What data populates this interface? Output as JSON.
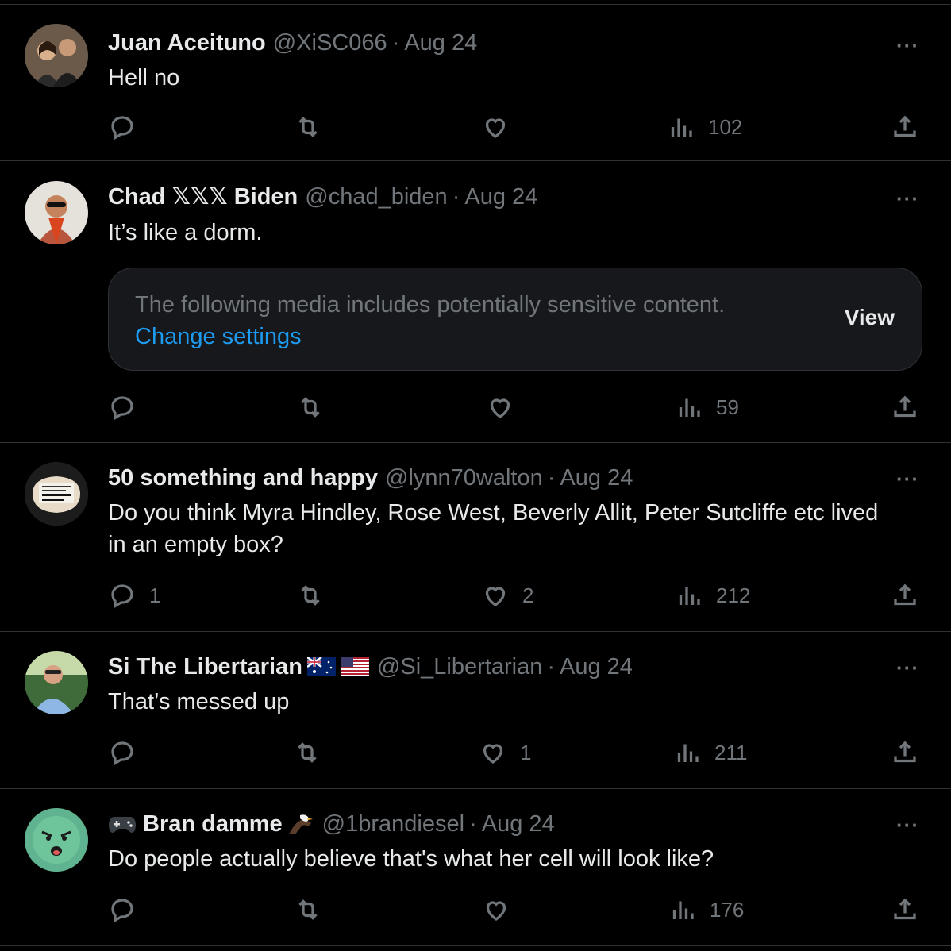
{
  "tweets": [
    {
      "name": "Juan Aceituno",
      "handle": "@XiSC066",
      "separator": "·",
      "date": "Aug 24",
      "text": "Hell no",
      "replies": "",
      "retweets": "",
      "likes": "",
      "views": "102"
    },
    {
      "name": "Chad 𝕏𝕏𝕏 Biden",
      "handle": "@chad_biden",
      "separator": "·",
      "date": "Aug 24",
      "text": "It’s like a dorm.",
      "sensitive": {
        "message": "The following media includes potentially sensitive content.",
        "change_settings": "Change settings",
        "view": "View"
      },
      "replies": "",
      "retweets": "",
      "likes": "",
      "views": "59"
    },
    {
      "name": "50 something and happy",
      "handle": "@lynn70walton",
      "separator": "·",
      "date": "Aug 24",
      "text": "Do you think Myra Hindley, Rose West, Beverly Allit, Peter Sutcliffe etc lived in an empty box?",
      "replies": "1",
      "retweets": "",
      "likes": "2",
      "views": "212"
    },
    {
      "name": "Si The Libertarian",
      "handle": "@Si_Libertarian",
      "separator": "·",
      "date": "Aug 24",
      "text": "That’s messed up",
      "replies": "",
      "retweets": "",
      "likes": "1",
      "views": "211"
    },
    {
      "name": "Bran damme",
      "handle": "@1brandiesel",
      "separator": "·",
      "date": "Aug 24",
      "text": "Do people actually believe that's what her cell will look like?",
      "replies": "",
      "retweets": "",
      "likes": "",
      "views": "176"
    }
  ],
  "more_label": "···",
  "colors": {
    "background": "#000000",
    "text": "#e7e9ea",
    "secondary": "#71767b",
    "link": "#1d9bf0",
    "border": "#2f3336"
  },
  "icons": [
    "reply-icon",
    "retweet-icon",
    "like-icon",
    "views-icon",
    "share-icon",
    "more-icon",
    "australia-flag-icon",
    "usa-flag-icon",
    "game-controller-icon",
    "eagle-icon"
  ]
}
